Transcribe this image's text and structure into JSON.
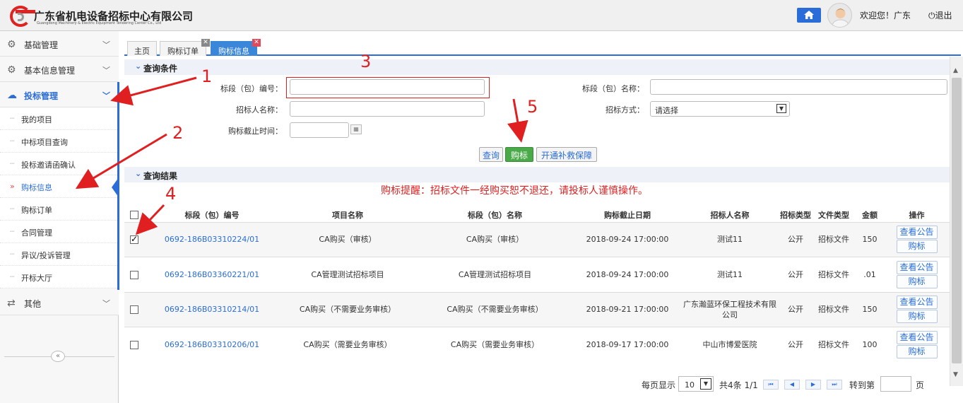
{
  "header": {
    "company_cn": "广东省机电设备招标中心有限公司",
    "company_en": "Guangdong Machinery & Electric Equipment Tendering Center Co., Ltd",
    "welcome": "欢迎您！广东",
    "logout": "退出"
  },
  "sidebar": {
    "menus": [
      {
        "label": "基础管理",
        "icon": "gear-icon"
      },
      {
        "label": "基本信息管理",
        "icon": "gear-icon"
      },
      {
        "label": "投标管理",
        "icon": "cloud-upload-icon"
      },
      {
        "label": "其他",
        "icon": "exchange-icon"
      }
    ],
    "sub_items": [
      "我的项目",
      "中标项目查询",
      "投标邀请函确认",
      "购标信息",
      "购标订单",
      "合同管理",
      "异议/投诉管理",
      "开标大厅"
    ]
  },
  "tabs": [
    "主页",
    "购标订单",
    "购标信息"
  ],
  "query": {
    "title": "查询条件",
    "label_code": "标段（包）编号：",
    "label_name": "标段（包）名称：",
    "label_tenderer": "招标人名称：",
    "label_method": "招标方式：",
    "method_value": "请选择",
    "label_deadline": "购标截止时间：",
    "btn_query": "查询",
    "btn_buy": "购标",
    "btn_insurance": "开通补救保障"
  },
  "results": {
    "title": "查询结果",
    "notice": "购标提醒：招标文件一经购买恕不退还，请投标人谨慎操作。",
    "columns": [
      "标段（包）编号",
      "项目名称",
      "标段（包）名称",
      "购标截止日期",
      "招标人名称",
      "招标类型",
      "文件类型",
      "金额",
      "操作"
    ],
    "rows": [
      {
        "code": "0692-186B03310224/01",
        "project": "CA购买（审核）",
        "section": "CA购买（审核）",
        "deadline": "2018-09-24 17:00:00",
        "tenderer": "测试11",
        "type": "公开",
        "file": "招标文件",
        "amount": "150",
        "checked": true
      },
      {
        "code": "0692-186B03360221/01",
        "project": "CA管理测试招标项目",
        "section": "CA管理测试招标项目",
        "deadline": "2018-09-24 17:00:00",
        "tenderer": "测试11",
        "type": "公开",
        "file": "招标文件",
        "amount": ".01",
        "checked": false
      },
      {
        "code": "0692-186B03310214/01",
        "project": "CA购买（不需要业务审核）",
        "section": "CA购买（不需要业务审核）",
        "deadline": "2018-09-21 17:00:00",
        "tenderer": "广东瀚蓝环保工程技术有限公司",
        "type": "公开",
        "file": "招标文件",
        "amount": "150",
        "checked": false
      },
      {
        "code": "0692-186B03310206/01",
        "project": "CA购买（需要业务审核）",
        "section": "CA购买（需要业务审核）",
        "deadline": "2018-09-17 17:00:00",
        "tenderer": "中山市博爱医院",
        "type": "公开",
        "file": "招标文件",
        "amount": "100",
        "checked": false
      }
    ],
    "op_view": "查看公告",
    "op_buy": "购标"
  },
  "pager": {
    "per_page_label": "每页显示",
    "per_page": "10",
    "summary": "共4条 1/1",
    "goto_label": "转到第",
    "page_unit": "页"
  },
  "annotations": [
    "1",
    "2",
    "3",
    "4",
    "5"
  ],
  "colors": {
    "accent": "#2a6dd8",
    "annotation": "#e02020",
    "buy_button": "#4aaa4a"
  }
}
